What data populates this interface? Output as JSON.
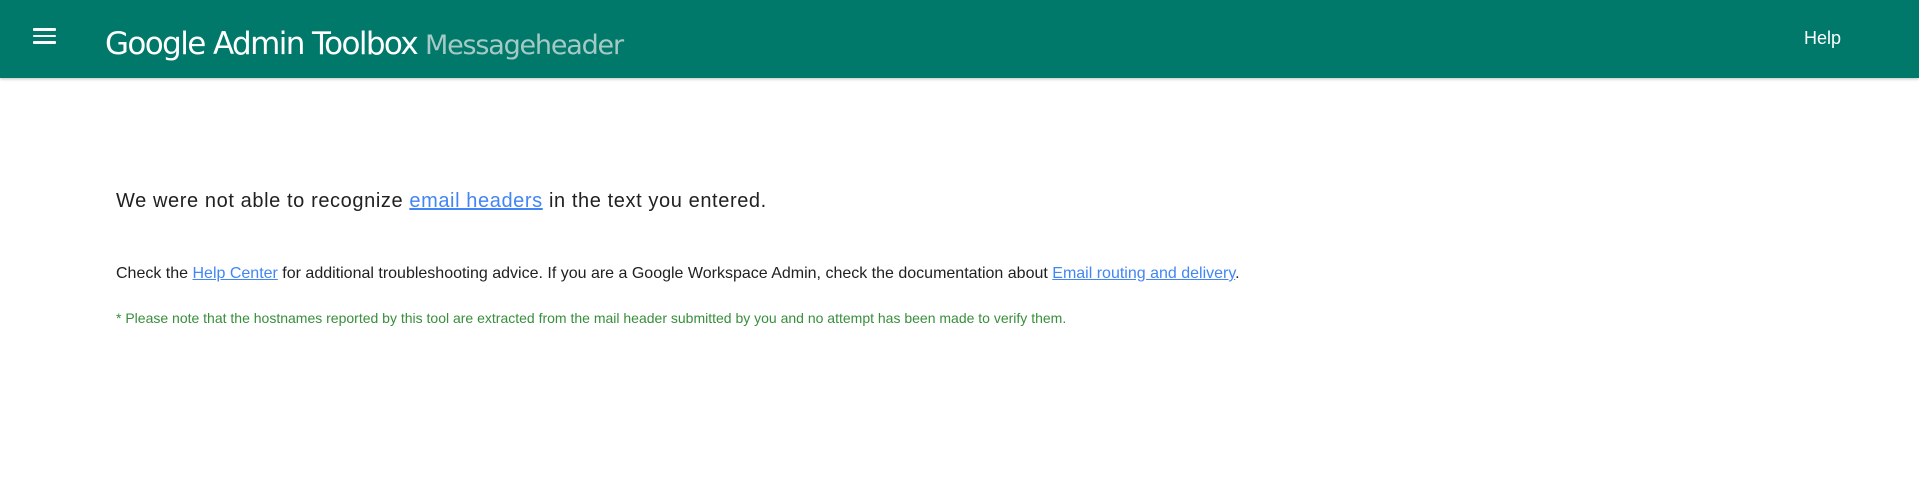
{
  "header": {
    "menu_icon": "hamburger-menu-icon",
    "app_title": "Google Admin Toolbox",
    "tool_name": "Messageheader",
    "help_label": "Help",
    "background_color": "#00796b",
    "tool_name_color": "#a5c9c4"
  },
  "main": {
    "headline": {
      "before": "We were not able to recognize ",
      "link": "email headers",
      "after": " in the text you entered."
    },
    "advice": {
      "before": "Check the ",
      "help_center_link": "Help Center",
      "middle": " for additional troubleshooting advice. If you are a Google Workspace Admin, check the documentation about ",
      "routing_link": "Email routing and delivery",
      "after": "."
    },
    "note": "* Please note that the hostnames reported by this tool are extracted from the mail header submitted by you and no attempt has been made to verify them.",
    "link_color": "#4285f4",
    "note_color": "#388e3c"
  }
}
